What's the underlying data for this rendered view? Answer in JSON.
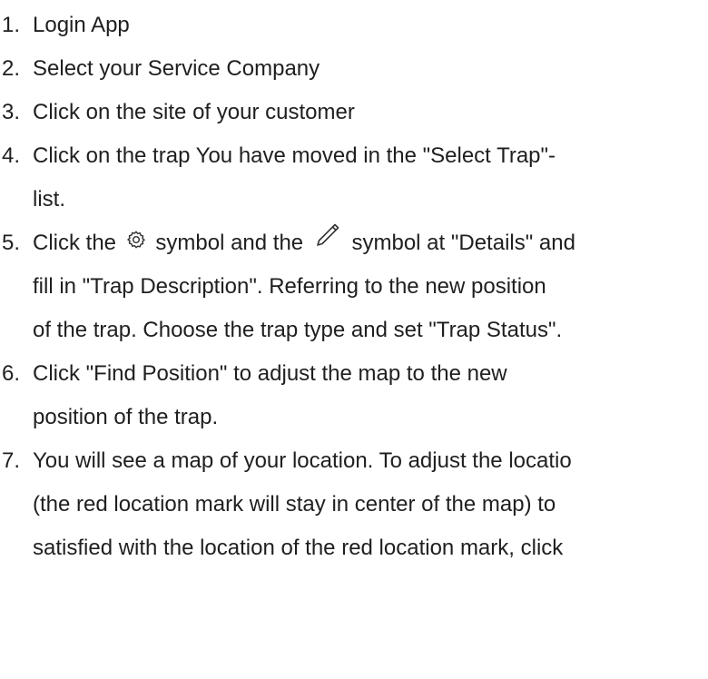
{
  "steps": [
    {
      "number": "1.",
      "lines": [
        "Login App"
      ]
    },
    {
      "number": "2.",
      "lines": [
        "Select your Service Company"
      ]
    },
    {
      "number": "3.",
      "lines": [
        "Click on the site of your customer"
      ]
    },
    {
      "number": "4.",
      "lines": [
        "Click on the trap You have moved in the \"Select Trap\"-",
        "list."
      ]
    },
    {
      "number": "5.",
      "first_line": {
        "a": "Click the",
        "icon1": "gear-icon",
        "b": "symbol and the",
        "icon2": "pencil-icon",
        "c": "symbol at \"Details\" and"
      },
      "lines": [
        "fill in \"Trap Description\". Referring to the new position",
        "of the trap. Choose the trap type and set \"Trap Status\"."
      ]
    },
    {
      "number": "6.",
      "lines": [
        "Click \"Find Position\" to adjust the map to the new",
        "position of the trap."
      ]
    },
    {
      "number": "7.",
      "lines": [
        "You will see a map of your location. To adjust the locatio",
        "(the red location mark will stay in center of the map) to",
        "satisfied with the location of the red location mark, click"
      ]
    }
  ]
}
